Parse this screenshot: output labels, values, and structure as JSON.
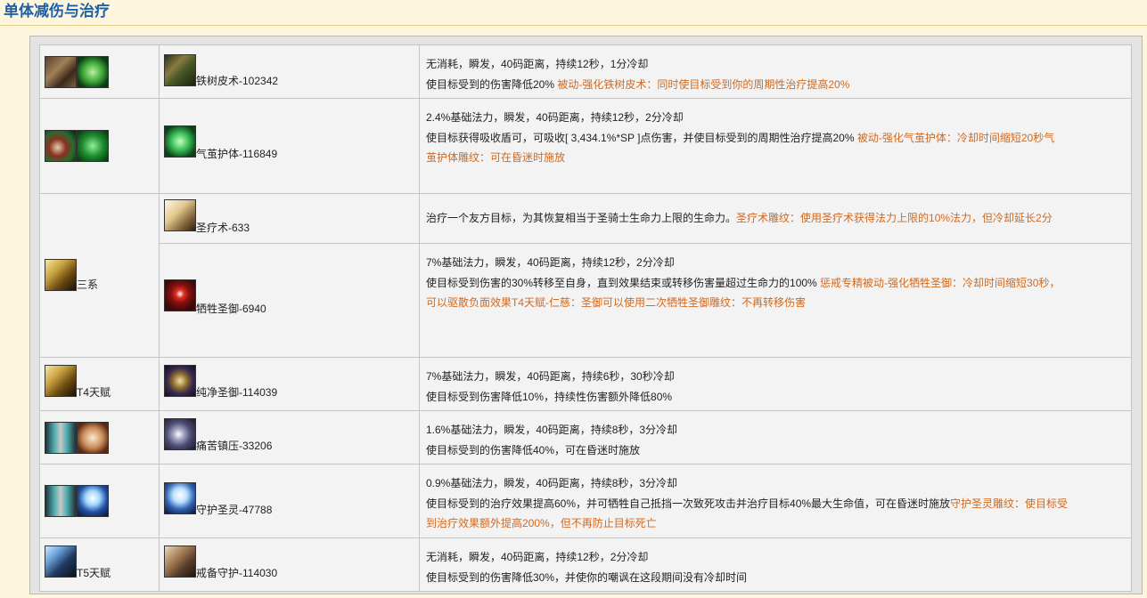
{
  "header": {
    "title": "单体减伤与治疗"
  },
  "rows": [
    {
      "col1": {
        "icons": [
          "bark-class-icon",
          "bark-leaf-icon"
        ],
        "label": ""
      },
      "skill": {
        "icon": "ironbark-icon",
        "name": "铁树皮术-102342"
      },
      "line1": "无消耗，瞬发，40码距离，持续12秒，1分冷却",
      "line2": "使目标受到的伤害降低20% ",
      "line2_hl": "被动-强化铁树皮术：同时使目标受到你的周期性治疗提高20%"
    },
    {
      "col1": {
        "icons": [
          "cocoon-class-icon",
          "cocoon-orb-icon"
        ],
        "label": ""
      },
      "skill": {
        "icon": "life-cocoon-icon",
        "name": "气茧护体-116849"
      },
      "line1": "2.4%基础法力，瞬发，40码距离，持续12秒，2分冷却",
      "line2": "使目标获得吸收盾可，可吸收[ 3,434.1%*SP ]点伤害，并使目标受到的周期性治疗提高20% ",
      "line2_hl": "被动-强化气茧护体：冷却时间缩短20秒气",
      "line3_hl": "茧护体雕纹：可在昏迷时施放"
    },
    {
      "col1": {
        "icons": [
          "paladin-class-icon"
        ],
        "label": "三系"
      },
      "skill": {
        "icon": "lay-on-hands-icon",
        "name": "圣疗术-633"
      },
      "line1": "治疗一个友方目标，为其恢复相当于圣骑士生命力上限的生命力。",
      "line1_hl": "圣疗术雕纹：使用圣疗术获得法力上限的10%法力，但冷却延长2分"
    },
    {
      "skill": {
        "icon": "hand-of-sacrifice-icon",
        "name": "牺牲圣御-6940"
      },
      "line1": "7%基础法力，瞬发，40码距离，持续12秒，2分冷却",
      "line2": "使目标受到伤害的30%转移至自身，直到效果结束或转移伤害量超过生命力的100% ",
      "line2_hl": "惩戒专精被动-强化牺牲圣御：冷却时间缩短30秒，",
      "line3_hl": "可以驱散负面效果T4天赋-仁慈：圣御可以使用二次牺牲圣御雕纹：不再转移伤害"
    },
    {
      "col1": {
        "icons": [
          "paladin-t4-icon"
        ],
        "label": "T4天赋"
      },
      "skill": {
        "icon": "hand-of-purity-icon",
        "name": "纯净圣御-114039"
      },
      "line1": "7%基础法力，瞬发，40码距离，持续6秒，30秒冷却",
      "line2": "使目标受到伤害降低10%，持续性伤害额外降低80%"
    },
    {
      "col1": {
        "icons": [
          "discipline-class-icon",
          "shield-rune-icon"
        ],
        "label": ""
      },
      "skill": {
        "icon": "pain-suppression-icon",
        "name": "痛苦镇压-33206"
      },
      "line1": "1.6%基础法力，瞬发，40码距离，持续8秒，3分冷却",
      "line2": "使目标受到的伤害降低40%，可在昏迷时施放"
    },
    {
      "col1": {
        "icons": [
          "holy-class-icon",
          "spirit-class-icon"
        ],
        "label": ""
      },
      "skill": {
        "icon": "guardian-spirit-icon",
        "name": "守护圣灵-47788"
      },
      "line1": "0.9%基础法力，瞬发，40码距离，持续8秒，3分冷却",
      "line2": "使目标受到的治疗效果提高60%，并可牺牲自己抵挡一次致死攻击并治疗目标40%最大生命值，可在昏迷时施放",
      "line2_hl": "守护圣灵雕纹：使目标受",
      "line3_hl": "到治疗效果额外提高200%，但不再防止目标死亡"
    },
    {
      "col1": {
        "icons": [
          "warrior-t5-icon"
        ],
        "label": "T5天赋"
      },
      "skill": {
        "icon": "vigilance-icon",
        "name": "戒备守护-114030"
      },
      "line1": "无消耗，瞬发，40码距离，持续12秒，2分冷却",
      "line2": "使目标受到的伤害降低30%，并使你的嘲讽在这段期间没有冷却时间"
    }
  ]
}
